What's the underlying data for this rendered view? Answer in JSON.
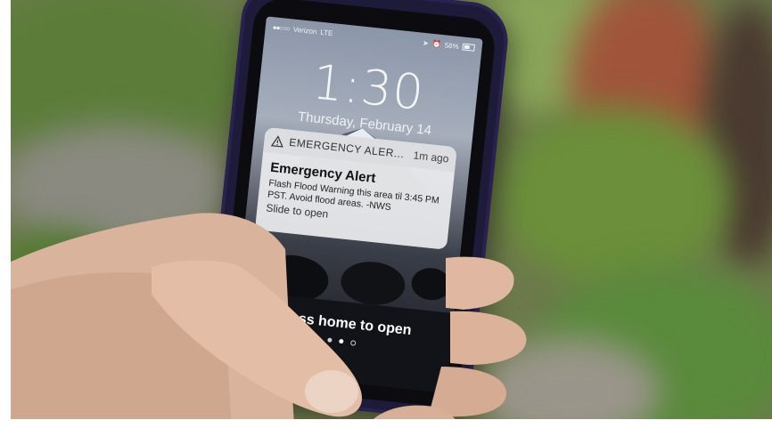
{
  "status_bar": {
    "carrier": "Verizon",
    "network": "LTE",
    "battery": "58%"
  },
  "lock_screen": {
    "time": "1:30",
    "date": "Thursday, February 14",
    "press_home": "Press home to open"
  },
  "notification": {
    "app_label": "EMERGENCY ALER...",
    "age": "1m ago",
    "title": "Emergency Alert",
    "message": "Flash Flood Warning this area til 3:45 PM PST. Avoid flood areas. -NWS",
    "action": "Slide to open"
  },
  "page_indicator": {
    "count": 3,
    "active_index": 1
  },
  "colors": {
    "phone_case": "#1e1a3a",
    "notification_bg": "#ecedef",
    "foliage": "#5f7a3c"
  }
}
